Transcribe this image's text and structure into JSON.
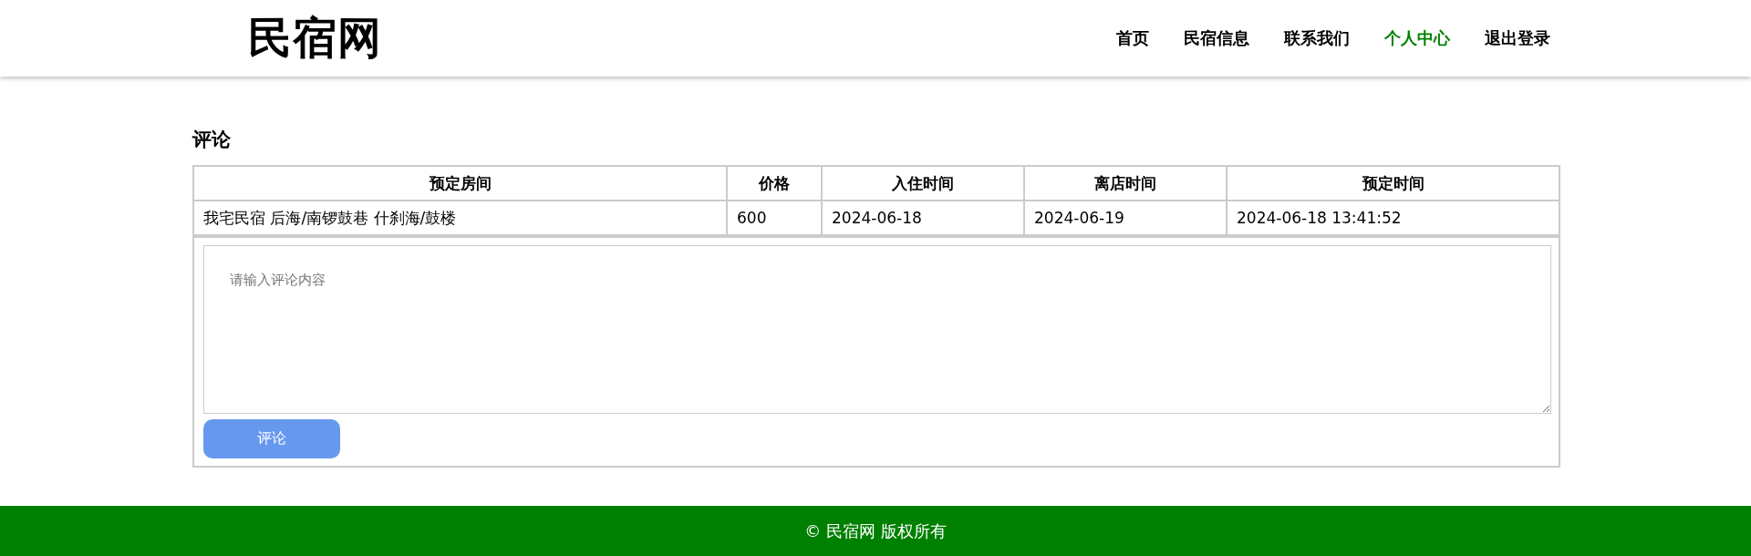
{
  "header": {
    "logo": "民宿网",
    "nav": [
      {
        "label": "首页",
        "selected": false
      },
      {
        "label": "民宿信息",
        "selected": false
      },
      {
        "label": "联系我们",
        "selected": false
      },
      {
        "label": "个人中心",
        "selected": true
      },
      {
        "label": "退出登录",
        "selected": false
      }
    ]
  },
  "section_title": "评论",
  "table": {
    "columns": [
      "预定房间",
      "价格",
      "入住时间",
      "离店时间",
      "预定时间"
    ],
    "rows": [
      [
        "我宅民宿 后海/南锣鼓巷 什刹海/鼓楼",
        "600",
        "2024-06-18",
        "2024-06-19",
        "2024-06-18 13:41:52"
      ]
    ]
  },
  "comment": {
    "placeholder": "请输入评论内容",
    "button": "评论"
  },
  "footer": "© 民宿网 版权所有"
}
